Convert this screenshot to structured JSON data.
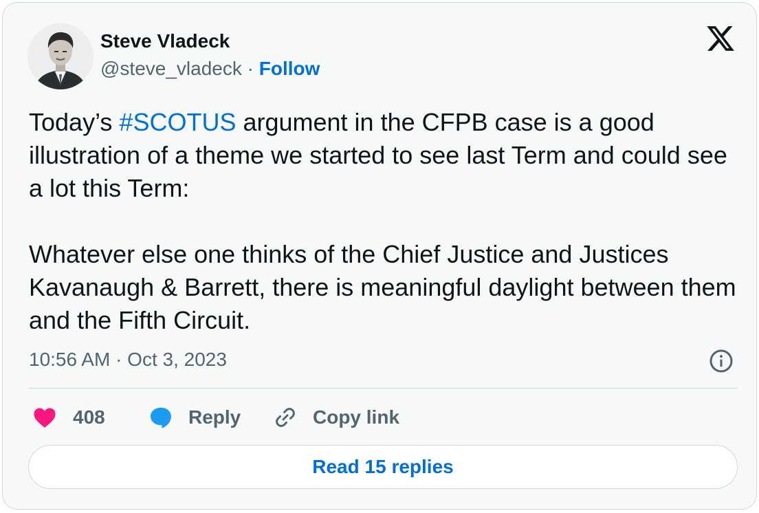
{
  "author": {
    "name": "Steve Vladeck",
    "handle": "@steve_vladeck",
    "separator": "·",
    "follow_label": "Follow"
  },
  "brand": {
    "icon": "x-logo-icon"
  },
  "tweet": {
    "para1_before": "Today’s ",
    "hashtag": "#SCOTUS",
    "para1_after": " argument in the CFPB case is a good illustration of a theme we started to see last Term and could see a lot this Term:",
    "para2": "Whatever else one thinks of the Chief Justice and Justices Kavanaugh & Barrett, there is meaningful daylight between them and the Fifth Circuit."
  },
  "meta": {
    "timestamp": "10:56 AM · Oct 3, 2023"
  },
  "actions": {
    "likes": "408",
    "reply_label": "Reply",
    "copy_label": "Copy link"
  },
  "read_replies": "Read 15 replies",
  "colors": {
    "link": "#006fd6",
    "like": "#f91880",
    "reply": "#1d9bf0",
    "muted": "#536471",
    "text": "#0f1419",
    "background": "#f7f9f9",
    "border": "#cfd9de"
  }
}
